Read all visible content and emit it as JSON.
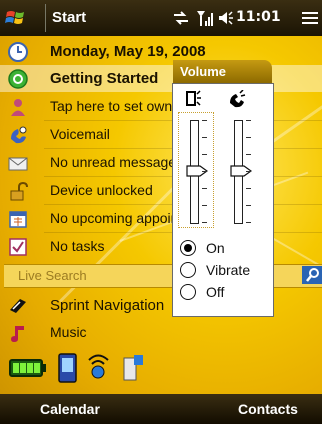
{
  "topbar": {
    "start_label": "Start",
    "clock": "11:01"
  },
  "today": {
    "date": "Monday, May 19, 2008",
    "getting_started": "Getting Started",
    "owner": "Tap here to set owner information",
    "voicemail": "Voicemail",
    "messages": "No unread messages",
    "device": "Device unlocked",
    "appointments": "No upcoming appointments",
    "tasks": "No tasks"
  },
  "search": {
    "placeholder": "Live Search"
  },
  "launcher": {
    "sprint_nav": "Sprint Navigation",
    "music": "Music"
  },
  "softkeys": {
    "left": "Calendar",
    "right": "Contacts"
  },
  "volume": {
    "title": "Volume",
    "system_level": 0.5,
    "ringer_level": 0.5,
    "options": [
      "On",
      "Vibrate",
      "Off"
    ],
    "selected": "On"
  },
  "colors": {
    "accent": "#f5c800",
    "bar": "#2b210a",
    "search_button": "#2a64b4"
  }
}
